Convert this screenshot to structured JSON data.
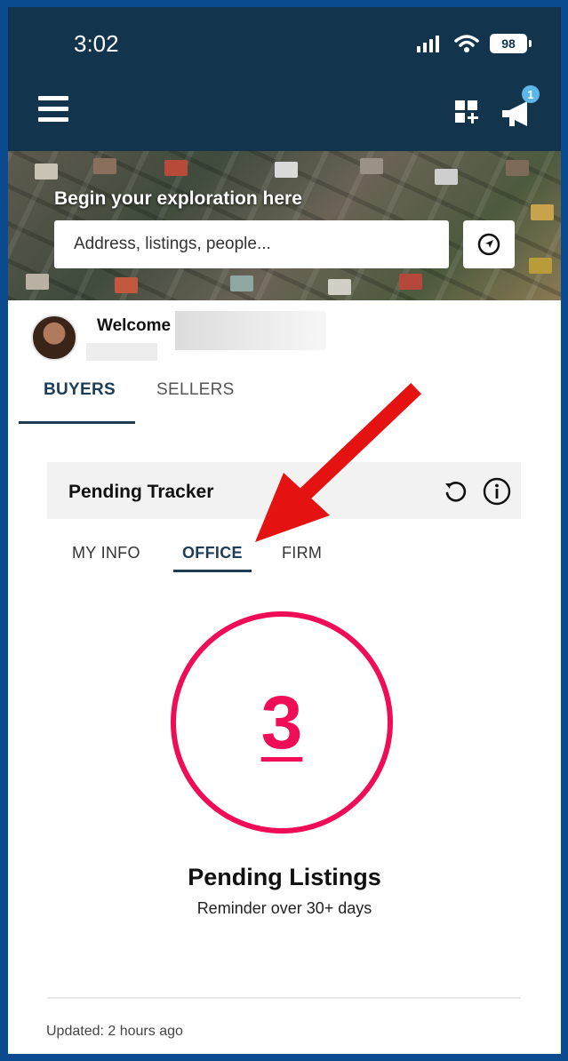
{
  "status_bar": {
    "time": "3:02",
    "battery": "98"
  },
  "header": {
    "notification_count": "1"
  },
  "hero": {
    "title": "Begin your exploration here",
    "search_placeholder": "Address, listings, people..."
  },
  "welcome": {
    "text": "Welcome"
  },
  "tabs": [
    {
      "label": "BUYERS",
      "active": true
    },
    {
      "label": "SELLERS",
      "active": false
    }
  ],
  "tracker": {
    "title": "Pending Tracker",
    "subtabs": [
      {
        "label": "MY INFO",
        "active": false
      },
      {
        "label": "OFFICE",
        "active": true
      },
      {
        "label": "FIRM",
        "active": false
      }
    ],
    "count": "3",
    "label": "Pending Listings",
    "sublabel": "Reminder over 30+ days",
    "updated": "Updated: 2 hours ago"
  },
  "colors": {
    "header": "#12344d",
    "accent": "#ee0d56",
    "tab_active": "#1d3d56",
    "annotation_arrow": "#e51212"
  },
  "icons": [
    "hamburger-menu-icon",
    "signal-icon",
    "wifi-icon",
    "battery-icon",
    "add-widget-icon",
    "megaphone-icon",
    "location-arrow-icon",
    "refresh-icon",
    "info-icon"
  ]
}
